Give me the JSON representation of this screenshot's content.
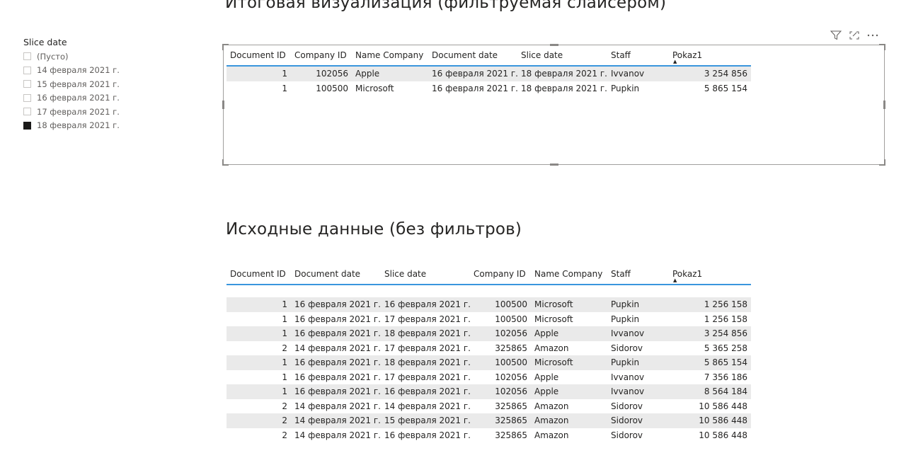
{
  "titles": {
    "filtered": "Итоговая визуализация (фильтруемая слайсером)",
    "source": "Исходные данные (без фильтров)"
  },
  "slicer": {
    "header": "Slice date",
    "items": [
      {
        "label": "(Пусто)",
        "checked": false
      },
      {
        "label": "14 февраля 2021 г.",
        "checked": false
      },
      {
        "label": "15 февраля 2021 г.",
        "checked": false
      },
      {
        "label": "16 февраля 2021 г.",
        "checked": false
      },
      {
        "label": "17 февраля 2021 г.",
        "checked": false
      },
      {
        "label": "18 февраля 2021 г.",
        "checked": true
      }
    ]
  },
  "toolbar": {
    "icons": [
      "filter-icon",
      "focus-mode-icon",
      "more-options-icon"
    ]
  },
  "table1": {
    "columns": [
      "Document ID",
      "Company ID",
      "Name Company",
      "Document date",
      "Slice date",
      "Staff",
      "Pokaz1"
    ],
    "sort_column": "Pokaz1",
    "rows": [
      [
        "1",
        "102056",
        "Apple",
        "16 февраля 2021 г.",
        "18 февраля 2021 г.",
        "Ivvanov",
        "3 254 856"
      ],
      [
        "1",
        "100500",
        "Microsoft",
        "16 февраля 2021 г.",
        "18 февраля 2021 г.",
        "Pupkin",
        "5 865 154"
      ]
    ]
  },
  "table2": {
    "columns": [
      "Document ID",
      "Document date",
      "Slice date",
      "Company ID",
      "Name Company",
      "Staff",
      "Pokaz1"
    ],
    "sort_column": "Pokaz1",
    "rows": [
      [
        "1",
        "16 февраля 2021 г.",
        "16 февраля 2021 г.",
        "100500",
        "Microsoft",
        "Pupkin",
        "1 256 158"
      ],
      [
        "1",
        "16 февраля 2021 г.",
        "17 февраля 2021 г.",
        "100500",
        "Microsoft",
        "Pupkin",
        "1 256 158"
      ],
      [
        "1",
        "16 февраля 2021 г.",
        "18 февраля 2021 г.",
        "102056",
        "Apple",
        "Ivvanov",
        "3 254 856"
      ],
      [
        "2",
        "14 февраля 2021 г.",
        "17 февраля 2021 г.",
        "325865",
        "Amazon",
        "Sidorov",
        "5 365 258"
      ],
      [
        "1",
        "16 февраля 2021 г.",
        "18 февраля 2021 г.",
        "100500",
        "Microsoft",
        "Pupkin",
        "5 865 154"
      ],
      [
        "1",
        "16 февраля 2021 г.",
        "17 февраля 2021 г.",
        "102056",
        "Apple",
        "Ivvanov",
        "7 356 186"
      ],
      [
        "1",
        "16 февраля 2021 г.",
        "16 февраля 2021 г.",
        "102056",
        "Apple",
        "Ivvanov",
        "8 564 184"
      ],
      [
        "2",
        "14 февраля 2021 г.",
        "14 февраля 2021 г.",
        "325865",
        "Amazon",
        "Sidorov",
        "10 586 448"
      ],
      [
        "2",
        "14 февраля 2021 г.",
        "15 февраля 2021 г.",
        "325865",
        "Amazon",
        "Sidorov",
        "10 586 448"
      ],
      [
        "2",
        "14 февраля 2021 г.",
        "16 февраля 2021 г.",
        "325865",
        "Amazon",
        "Sidorov",
        "10 586 448"
      ]
    ]
  }
}
